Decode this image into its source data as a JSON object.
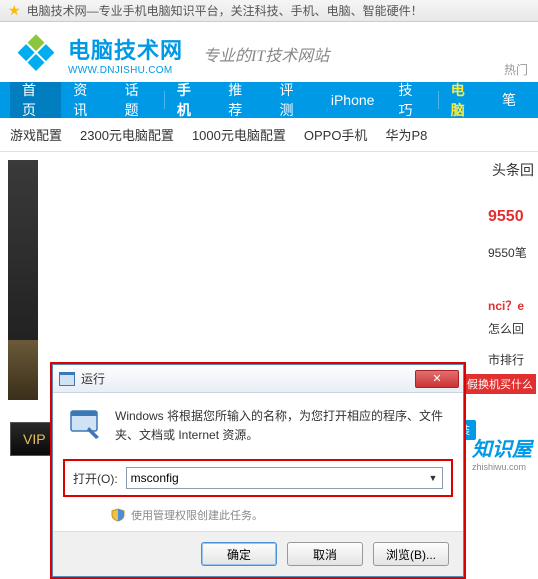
{
  "browser": {
    "title": "电脑技术网—专业手机电脑知识平台，关注科技、手机、电脑、智能硬件！"
  },
  "site": {
    "name_cn": "电脑技术网",
    "name_en": "WWW.DNJISHU.COM",
    "slogan": "专业的IT技术网站",
    "hotword_label": "热门"
  },
  "nav": {
    "items": [
      "首页",
      "资讯",
      "话题",
      "手机",
      "推荐",
      "评测",
      "iPhone",
      "技巧",
      "电脑",
      "笔"
    ]
  },
  "subnav": {
    "items": [
      "游戏配置",
      "2300元电脑配置",
      "1000元电脑配置",
      "OPPO手机",
      "华为P8"
    ]
  },
  "right": {
    "headline": "头条回",
    "r1": "9550",
    "r2": "9550笔",
    "r3": "nci？e",
    "r4": "怎么回",
    "r5": "市排行",
    "promo": "暑假换机买什么"
  },
  "vip": {
    "label": "VIP"
  },
  "dialog": {
    "title": "运行",
    "desc": "Windows 将根据您所输入的名称，为您打开相应的程序、文件夹、文档或 Internet 资源。",
    "open_label": "打开(O):",
    "open_value": "msconfig",
    "shield_note": "使用管理权限创建此任务。",
    "ok": "确定",
    "cancel": "取消",
    "browse": "浏览(B)..."
  },
  "badge": {
    "cn": "知识屋",
    "en": "zhishiwu.com",
    "install": "安装"
  }
}
